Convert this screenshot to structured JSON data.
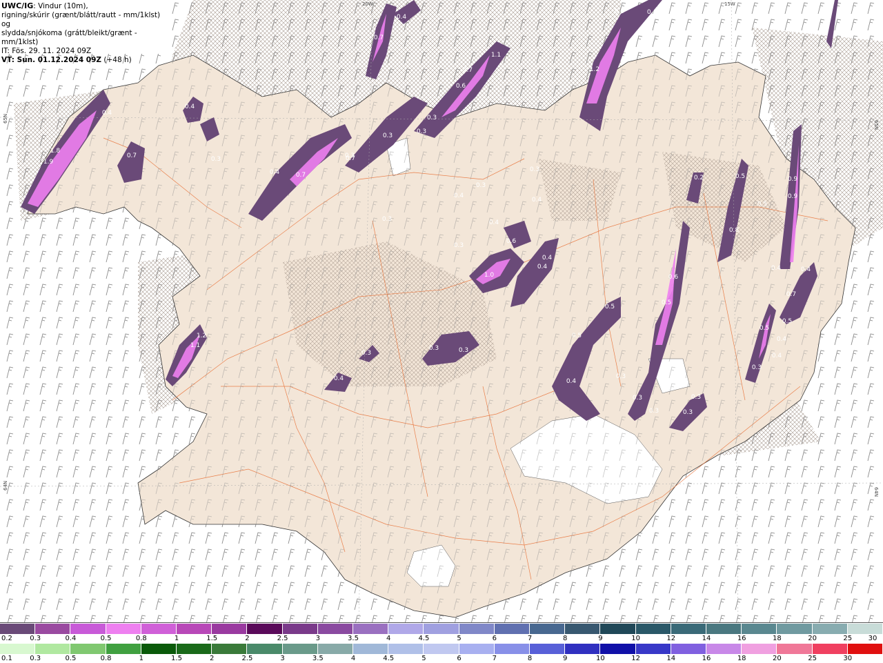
{
  "header": {
    "model": "UWC/IG",
    "line1_rest": ": Vindur (10m),",
    "line2": "rigning/skúrir (grænt/blátt/rautt - mm/1klst) og",
    "line3": "slydda/snjókoma (grátt/bleikt/grænt - mm/1klst)",
    "it_line": "IT: Fös. 29. 11. 2024 09Z",
    "vt_label": "VT: Sun. 01.12.2024 09Z",
    "vt_offset": " (+48 h)"
  },
  "map": {
    "land_color": "#f3e6d8",
    "sea_color": "#ffffff",
    "road_color": "#e8733a",
    "glacier_color": "#ffffff",
    "precip_colors": [
      "#6a4a78",
      "#9a4aa0",
      "#c85ad8",
      "#ee80f0"
    ],
    "grid_labels": [
      "20W",
      "15W",
      "65N",
      "64N",
      "65N",
      "64N"
    ],
    "precip_labels": [
      {
        "text": "0.4"
      },
      {
        "text": "0.7"
      },
      {
        "text": "0.5"
      },
      {
        "text": "1.2"
      },
      {
        "text": "0.4"
      },
      {
        "text": "1.1"
      },
      {
        "text": "0.7"
      },
      {
        "text": "0.6"
      },
      {
        "text": "0.3"
      },
      {
        "text": "0.3"
      },
      {
        "text": "0.3"
      },
      {
        "text": "0.4"
      },
      {
        "text": "0.4"
      },
      {
        "text": "1.8"
      },
      {
        "text": "1.9"
      },
      {
        "text": "0.7"
      },
      {
        "text": "0.3"
      },
      {
        "text": "0.4"
      },
      {
        "text": "0.7"
      },
      {
        "text": "0.3"
      },
      {
        "text": "0.7"
      },
      {
        "text": "0.3"
      },
      {
        "text": "0.4"
      },
      {
        "text": "0.3"
      },
      {
        "text": "0.4"
      },
      {
        "text": "0.3"
      },
      {
        "text": "0.6"
      },
      {
        "text": "0.4"
      },
      {
        "text": "1.0"
      },
      {
        "text": "0.4"
      },
      {
        "text": "0.4"
      },
      {
        "text": "0.3"
      },
      {
        "text": "0.2"
      },
      {
        "text": "0.5"
      },
      {
        "text": "0.5"
      },
      {
        "text": "0.8"
      },
      {
        "text": "0.9"
      },
      {
        "text": "0.9"
      },
      {
        "text": "0.4"
      },
      {
        "text": "0.7"
      },
      {
        "text": "0.5"
      },
      {
        "text": "0.4"
      },
      {
        "text": "0.4"
      },
      {
        "text": "0.3"
      },
      {
        "text": "0.5"
      },
      {
        "text": "0.4"
      },
      {
        "text": "0.6"
      },
      {
        "text": "0.5"
      },
      {
        "text": "0.5"
      },
      {
        "text": "0.5"
      },
      {
        "text": "0.4"
      },
      {
        "text": "0.3"
      },
      {
        "text": "0.3"
      },
      {
        "text": "0.3"
      },
      {
        "text": "0.3"
      },
      {
        "text": "0.3"
      },
      {
        "text": "1.2"
      },
      {
        "text": "1.1"
      },
      {
        "text": "0.3"
      },
      {
        "text": "0.3"
      },
      {
        "text": "0.3"
      },
      {
        "text": "0.4"
      }
    ]
  },
  "legend": {
    "snow": {
      "labels": [
        "0.2",
        "0.3",
        "0.4",
        "0.5",
        "0.8",
        "1",
        "1.5",
        "2",
        "2.5",
        "3",
        "3.5",
        "4",
        "4.5",
        "5",
        "6",
        "7",
        "8",
        "9",
        "10",
        "12",
        "14",
        "16",
        "18",
        "20",
        "25",
        "30"
      ],
      "colors": [
        "#6a4a78",
        "#9a4aa0",
        "#c85ad8",
        "#ee80f0",
        "#d060d8",
        "#b848b8",
        "#9a3aa0",
        "#5a0a5a",
        "#7a3a8a",
        "#8a4aa0",
        "#9a70c0",
        "#b0a8e8",
        "#a0a0e0",
        "#8088c8",
        "#6070b0",
        "#486890",
        "#385870",
        "#204858",
        "#2a5868",
        "#3a6a78",
        "#4a7880",
        "#5a8890",
        "#709aa0",
        "#88acb0",
        "#c8dcd8"
      ]
    },
    "rain": {
      "labels": [
        "0.1",
        "0.3",
        "0.5",
        "0.8",
        "1",
        "1.5",
        "2",
        "2.5",
        "3",
        "3.5",
        "4",
        "4.5",
        "5",
        "6",
        "7",
        "8",
        "9",
        "10",
        "12",
        "14",
        "16",
        "18",
        "20",
        "25",
        "30"
      ],
      "colors": [
        "#d8f8d0",
        "#b0e8a0",
        "#80c870",
        "#40a040",
        "#0a5a0a",
        "#1a6a1a",
        "#3a7a3a",
        "#4a8a6a",
        "#6a9a8a",
        "#88aaa8",
        "#a0b8d8",
        "#b0c0e8",
        "#c0c8f0",
        "#a8b0f0",
        "#8890e8",
        "#5860d8",
        "#3030c0",
        "#1010a8",
        "#3838c8",
        "#8060e0",
        "#c888e8",
        "#f0a0e0",
        "#f07898",
        "#f04060",
        "#e01010"
      ]
    }
  }
}
